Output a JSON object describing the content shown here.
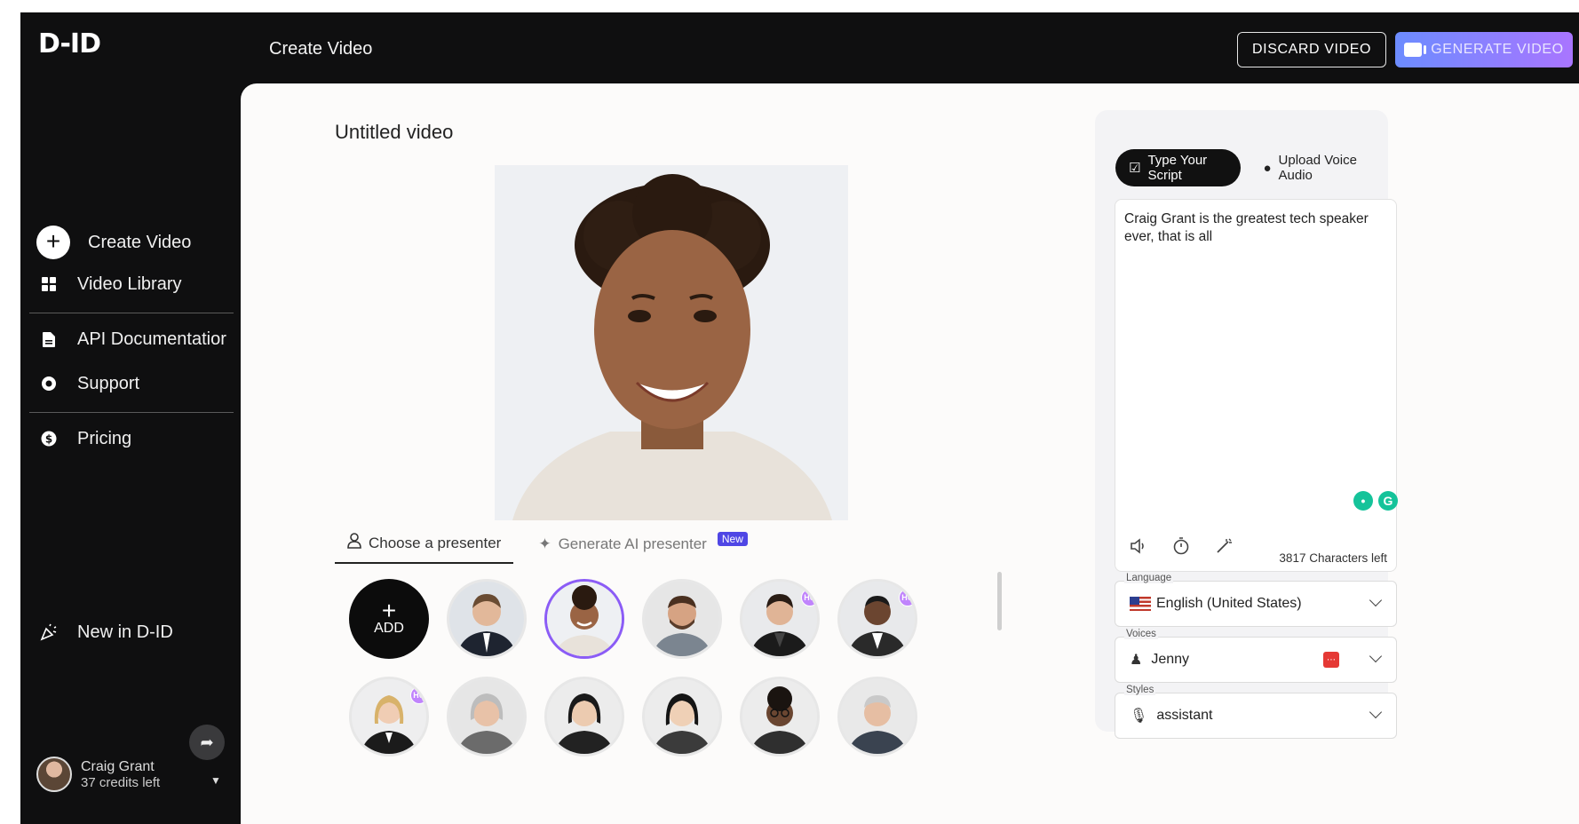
{
  "header": {
    "logo": "D-ID",
    "title": "Create Video",
    "discard_label": "DISCARD VIDEO",
    "generate_label": "GENERATE VIDEO"
  },
  "sidebar": {
    "items": [
      {
        "label": "Create Video",
        "icon": "plus-circle-icon"
      },
      {
        "label": "Video Library",
        "icon": "grid-icon"
      },
      {
        "label": "API Documentatior",
        "icon": "document-icon"
      },
      {
        "label": "Support",
        "icon": "lifebuoy-icon"
      },
      {
        "label": "Pricing",
        "icon": "dollar-icon"
      }
    ],
    "whats_new": "New in D-ID",
    "user": {
      "name": "Craig Grant",
      "credits": "37 credits left"
    }
  },
  "editor": {
    "video_title": "Untitled video",
    "tabs": {
      "choose": "Choose a presenter",
      "generate": "Generate AI presenter",
      "new_badge": "New"
    },
    "add_label": "ADD",
    "presenters": [
      {
        "hq": false
      },
      {
        "hq": false,
        "selected": true
      },
      {
        "hq": false
      },
      {
        "hq": true
      },
      {
        "hq": true
      },
      {
        "hq": true
      },
      {
        "hq": false
      },
      {
        "hq": false
      },
      {
        "hq": false
      },
      {
        "hq": false
      },
      {
        "hq": false
      }
    ],
    "hq_label": "HQ"
  },
  "script": {
    "tab_type": "Type Your Script",
    "tab_upload": "Upload Voice Audio",
    "text": "Craig Grant is the greatest tech speaker ever, that is all",
    "chars_left": "3817 Characters left",
    "language_label": "Language",
    "language_value": "English (United States)",
    "voices_label": "Voices",
    "voice_value": "Jenny",
    "styles_label": "Styles",
    "style_value": "assistant"
  },
  "colors": {
    "accent_gradient_start": "#6c8cff",
    "accent_gradient_end": "#a975ff",
    "selected_presenter": "#8b5cf6",
    "hq_badge": "#c084fc"
  }
}
